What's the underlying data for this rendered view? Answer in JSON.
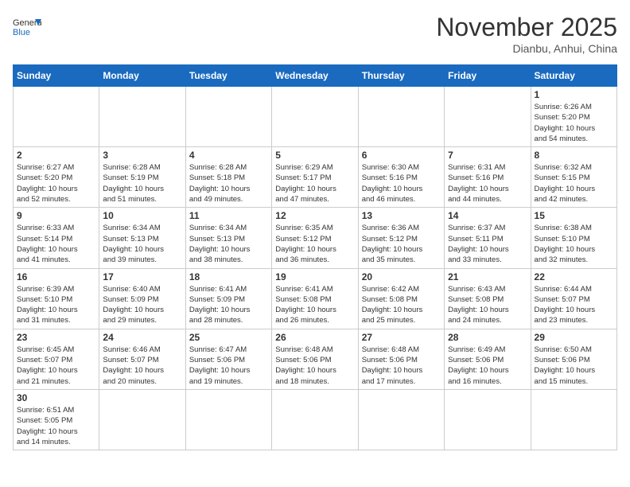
{
  "header": {
    "logo_general": "General",
    "logo_blue": "Blue",
    "month": "November 2025",
    "location": "Dianbu, Anhui, China"
  },
  "days_of_week": [
    "Sunday",
    "Monday",
    "Tuesday",
    "Wednesday",
    "Thursday",
    "Friday",
    "Saturday"
  ],
  "cells": [
    {
      "day": "",
      "text": ""
    },
    {
      "day": "",
      "text": ""
    },
    {
      "day": "",
      "text": ""
    },
    {
      "day": "",
      "text": ""
    },
    {
      "day": "",
      "text": ""
    },
    {
      "day": "",
      "text": ""
    },
    {
      "day": "1",
      "text": "Sunrise: 6:26 AM\nSunset: 5:20 PM\nDaylight: 10 hours\nand 54 minutes."
    },
    {
      "day": "2",
      "text": "Sunrise: 6:27 AM\nSunset: 5:20 PM\nDaylight: 10 hours\nand 52 minutes."
    },
    {
      "day": "3",
      "text": "Sunrise: 6:28 AM\nSunset: 5:19 PM\nDaylight: 10 hours\nand 51 minutes."
    },
    {
      "day": "4",
      "text": "Sunrise: 6:28 AM\nSunset: 5:18 PM\nDaylight: 10 hours\nand 49 minutes."
    },
    {
      "day": "5",
      "text": "Sunrise: 6:29 AM\nSunset: 5:17 PM\nDaylight: 10 hours\nand 47 minutes."
    },
    {
      "day": "6",
      "text": "Sunrise: 6:30 AM\nSunset: 5:16 PM\nDaylight: 10 hours\nand 46 minutes."
    },
    {
      "day": "7",
      "text": "Sunrise: 6:31 AM\nSunset: 5:16 PM\nDaylight: 10 hours\nand 44 minutes."
    },
    {
      "day": "8",
      "text": "Sunrise: 6:32 AM\nSunset: 5:15 PM\nDaylight: 10 hours\nand 42 minutes."
    },
    {
      "day": "9",
      "text": "Sunrise: 6:33 AM\nSunset: 5:14 PM\nDaylight: 10 hours\nand 41 minutes."
    },
    {
      "day": "10",
      "text": "Sunrise: 6:34 AM\nSunset: 5:13 PM\nDaylight: 10 hours\nand 39 minutes."
    },
    {
      "day": "11",
      "text": "Sunrise: 6:34 AM\nSunset: 5:13 PM\nDaylight: 10 hours\nand 38 minutes."
    },
    {
      "day": "12",
      "text": "Sunrise: 6:35 AM\nSunset: 5:12 PM\nDaylight: 10 hours\nand 36 minutes."
    },
    {
      "day": "13",
      "text": "Sunrise: 6:36 AM\nSunset: 5:12 PM\nDaylight: 10 hours\nand 35 minutes."
    },
    {
      "day": "14",
      "text": "Sunrise: 6:37 AM\nSunset: 5:11 PM\nDaylight: 10 hours\nand 33 minutes."
    },
    {
      "day": "15",
      "text": "Sunrise: 6:38 AM\nSunset: 5:10 PM\nDaylight: 10 hours\nand 32 minutes."
    },
    {
      "day": "16",
      "text": "Sunrise: 6:39 AM\nSunset: 5:10 PM\nDaylight: 10 hours\nand 31 minutes."
    },
    {
      "day": "17",
      "text": "Sunrise: 6:40 AM\nSunset: 5:09 PM\nDaylight: 10 hours\nand 29 minutes."
    },
    {
      "day": "18",
      "text": "Sunrise: 6:41 AM\nSunset: 5:09 PM\nDaylight: 10 hours\nand 28 minutes."
    },
    {
      "day": "19",
      "text": "Sunrise: 6:41 AM\nSunset: 5:08 PM\nDaylight: 10 hours\nand 26 minutes."
    },
    {
      "day": "20",
      "text": "Sunrise: 6:42 AM\nSunset: 5:08 PM\nDaylight: 10 hours\nand 25 minutes."
    },
    {
      "day": "21",
      "text": "Sunrise: 6:43 AM\nSunset: 5:08 PM\nDaylight: 10 hours\nand 24 minutes."
    },
    {
      "day": "22",
      "text": "Sunrise: 6:44 AM\nSunset: 5:07 PM\nDaylight: 10 hours\nand 23 minutes."
    },
    {
      "day": "23",
      "text": "Sunrise: 6:45 AM\nSunset: 5:07 PM\nDaylight: 10 hours\nand 21 minutes."
    },
    {
      "day": "24",
      "text": "Sunrise: 6:46 AM\nSunset: 5:07 PM\nDaylight: 10 hours\nand 20 minutes."
    },
    {
      "day": "25",
      "text": "Sunrise: 6:47 AM\nSunset: 5:06 PM\nDaylight: 10 hours\nand 19 minutes."
    },
    {
      "day": "26",
      "text": "Sunrise: 6:48 AM\nSunset: 5:06 PM\nDaylight: 10 hours\nand 18 minutes."
    },
    {
      "day": "27",
      "text": "Sunrise: 6:48 AM\nSunset: 5:06 PM\nDaylight: 10 hours\nand 17 minutes."
    },
    {
      "day": "28",
      "text": "Sunrise: 6:49 AM\nSunset: 5:06 PM\nDaylight: 10 hours\nand 16 minutes."
    },
    {
      "day": "29",
      "text": "Sunrise: 6:50 AM\nSunset: 5:06 PM\nDaylight: 10 hours\nand 15 minutes."
    },
    {
      "day": "30",
      "text": "Sunrise: 6:51 AM\nSunset: 5:05 PM\nDaylight: 10 hours\nand 14 minutes."
    },
    {
      "day": "",
      "text": ""
    },
    {
      "day": "",
      "text": ""
    },
    {
      "day": "",
      "text": ""
    },
    {
      "day": "",
      "text": ""
    },
    {
      "day": "",
      "text": ""
    },
    {
      "day": "",
      "text": ""
    }
  ]
}
